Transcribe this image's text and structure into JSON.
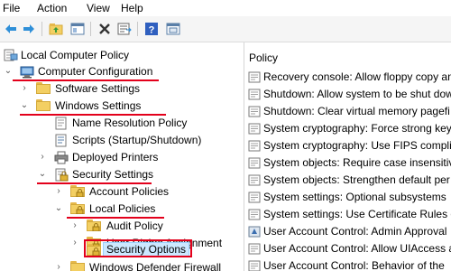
{
  "menu": {
    "file": "File",
    "action": "Action",
    "view": "View",
    "help": "Help"
  },
  "toolbar": {
    "back": "back-arrow-icon",
    "forward": "forward-arrow-icon",
    "up": "up-folder-icon",
    "show_hide": "console-tree-icon",
    "delete": "delete-icon",
    "export": "export-list-icon",
    "help": "help-icon",
    "properties": "properties-icon"
  },
  "tree": {
    "root": "Local Computer Policy",
    "computer_configuration": "Computer Configuration",
    "software_settings": "Software Settings",
    "windows_settings": "Windows Settings",
    "name_resolution_policy": "Name Resolution Policy",
    "scripts": "Scripts (Startup/Shutdown)",
    "deployed_printers": "Deployed Printers",
    "security_settings": "Security Settings",
    "account_policies": "Account Policies",
    "local_policies": "Local Policies",
    "audit_policy": "Audit Policy",
    "user_rights_assignment": "User Rights Assignment",
    "security_options": "Security Options",
    "windows_defender_firewall": "Windows Defender Firewall"
  },
  "policy_pane": {
    "header": "Policy",
    "items": [
      "Recovery console: Allow floppy copy an",
      "Shutdown: Allow system to be shut dow",
      "Shutdown: Clear virtual memory pagefi",
      "System cryptography: Force strong key",
      "System cryptography: Use FIPS complia",
      "System objects: Require case insensitiv",
      "System objects: Strengthen default per",
      "System settings: Optional subsystems",
      "System settings: Use Certificate Rules o",
      "User Account Control: Admin Approval",
      "User Account Control: Allow UIAccess a",
      "User Account Control: Behavior of the"
    ]
  },
  "colors": {
    "highlight": "#e3001b",
    "selection": "#cce8ff",
    "folder": "#f3cf62"
  }
}
